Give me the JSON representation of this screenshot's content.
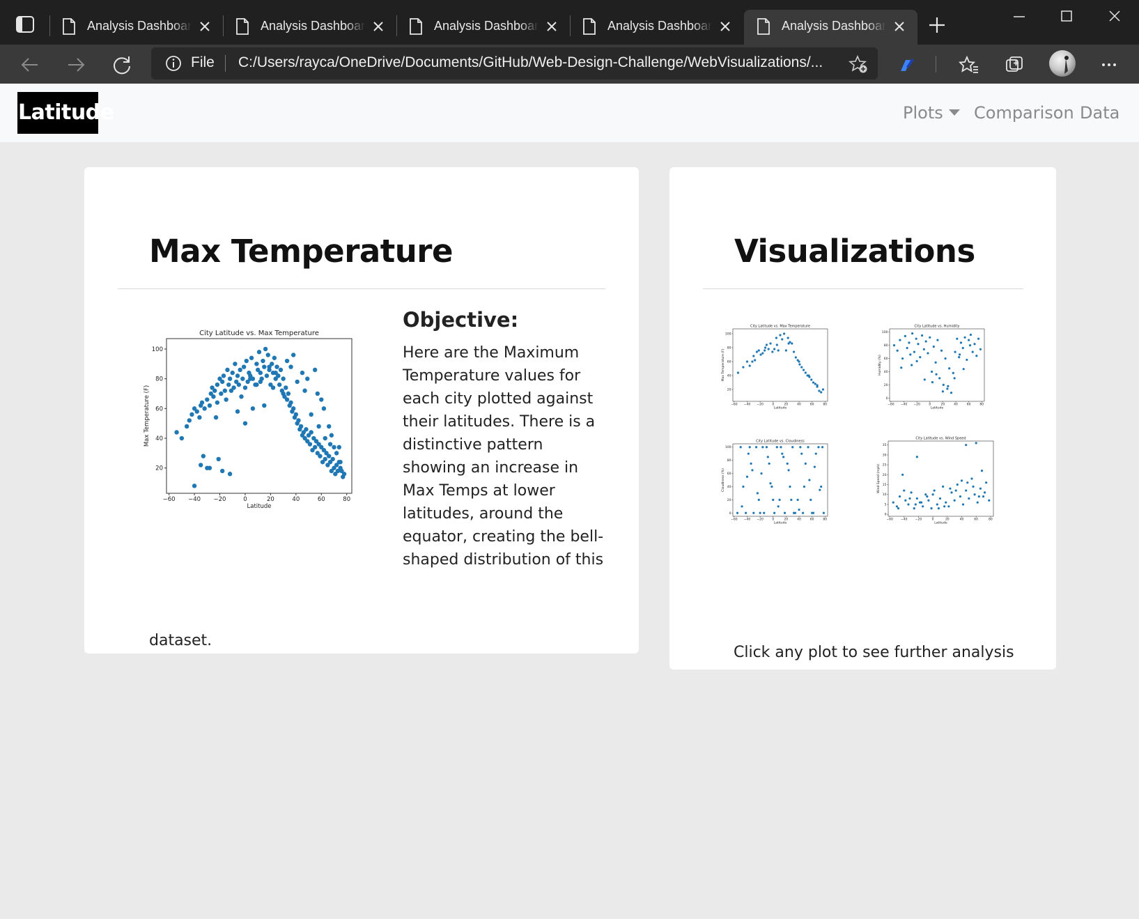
{
  "browser": {
    "tabs": [
      {
        "title": "Analysis Dashboard"
      },
      {
        "title": "Analysis Dashboard"
      },
      {
        "title": "Analysis Dashboard"
      },
      {
        "title": "Analysis Dashboard"
      },
      {
        "title": "Analysis Dashboard"
      }
    ],
    "active_tab_index": 4,
    "address_scheme_label": "File",
    "address_url": "C:/Users/rayca/OneDrive/Documents/GitHub/Web-Design-Challenge/WebVisualizations/..."
  },
  "site_nav": {
    "brand": "Latitude",
    "links": {
      "plots": "Plots",
      "comparison": "Comparison",
      "data": "Data"
    }
  },
  "main_card": {
    "title": "Max Temperature",
    "objective_heading": "Objective:",
    "objective_text": "Here are the Maximum Temperature values for each city plotted against their latitudes. There is a distinctive pattern showing an increase in Max Temps at lower latitudes, around the equator, creating the bell-shaped distribution of this",
    "objective_text_tail": "dataset."
  },
  "viz_card": {
    "title": "Visualizations",
    "caption": "Click any plot to see further analysis"
  },
  "chart_data": [
    {
      "type": "scatter",
      "title": "City Latitude vs. Max Temperature",
      "xlabel": "Latitude",
      "ylabel": "Max Temperature (F)",
      "xlim": [
        -62,
        84
      ],
      "ylim": [
        3,
        107
      ],
      "xticks": [
        -60,
        -40,
        -20,
        0,
        20,
        40,
        60,
        80
      ],
      "yticks": [
        20,
        40,
        60,
        80,
        100
      ],
      "color": "#1f77b4",
      "x": [
        -54,
        -50,
        -46,
        -44,
        -42,
        -40,
        -38,
        -36,
        -35,
        -34,
        -32,
        -30,
        -28,
        -27,
        -26,
        -25,
        -24,
        -22,
        -22,
        -20,
        -19,
        -18,
        -17,
        -16,
        -14,
        -13,
        -12,
        -10,
        -9,
        -8,
        -7,
        -6,
        -5,
        -4,
        -2,
        -1,
        0,
        1,
        2,
        3,
        4,
        5,
        6,
        8,
        9,
        10,
        11,
        12,
        13,
        14,
        15,
        16,
        17,
        18,
        19,
        20,
        21,
        22,
        23,
        24,
        25,
        26,
        27,
        28,
        29,
        30,
        31,
        32,
        33,
        34,
        35,
        36,
        37,
        38,
        39,
        40,
        41,
        42,
        43,
        44,
        45,
        46,
        47,
        48,
        49,
        50,
        51,
        52,
        53,
        54,
        55,
        56,
        57,
        58,
        59,
        60,
        61,
        62,
        63,
        64,
        65,
        66,
        67,
        68,
        69,
        70,
        71,
        72,
        73,
        74,
        75,
        76,
        77,
        78,
        -35,
        -28,
        -23,
        -15,
        -11,
        -3,
        4,
        12,
        19,
        26,
        33,
        41,
        47,
        52,
        58,
        63,
        67,
        72,
        75,
        -30,
        -18,
        -6,
        9,
        24,
        38,
        55,
        62,
        70,
        -40,
        -21,
        0,
        15,
        30,
        45,
        57,
        66,
        74,
        -33,
        -12,
        6,
        22,
        36,
        49,
        60,
        68
      ],
      "y": [
        44,
        40,
        48,
        52,
        56,
        60,
        58,
        54,
        62,
        64,
        60,
        66,
        62,
        70,
        74,
        68,
        72,
        76,
        64,
        80,
        70,
        78,
        82,
        72,
        86,
        76,
        80,
        84,
        74,
        90,
        78,
        82,
        76,
        86,
        80,
        88,
        74,
        92,
        78,
        84,
        82,
        94,
        80,
        76,
        90,
        86,
        98,
        84,
        80,
        92,
        88,
        100,
        82,
        96,
        86,
        76,
        90,
        84,
        94,
        80,
        88,
        82,
        76,
        86,
        72,
        80,
        68,
        74,
        66,
        70,
        62,
        64,
        58,
        60,
        54,
        56,
        50,
        52,
        46,
        48,
        42,
        44,
        40,
        46,
        38,
        42,
        36,
        44,
        32,
        40,
        34,
        38,
        30,
        36,
        28,
        34,
        24,
        32,
        26,
        30,
        22,
        28,
        24,
        18,
        26,
        20,
        16,
        22,
        18,
        24,
        20,
        18,
        14,
        16,
        22,
        20,
        54,
        66,
        72,
        68,
        80,
        78,
        88,
        82,
        92,
        78,
        72,
        56,
        48,
        40,
        36,
        30,
        24,
        20,
        18,
        58,
        76,
        84,
        96,
        86,
        60,
        34,
        8,
        26,
        50,
        62,
        70,
        84,
        70,
        48,
        34,
        28,
        16,
        60,
        74,
        88,
        80,
        66,
        42,
        38,
        24
      ]
    },
    {
      "type": "scatter",
      "title": "City Latitude vs. Max Temperature",
      "xlabel": "Latitude",
      "ylabel": "Max Temperature (F)",
      "xlim": [
        -62,
        84
      ],
      "ylim": [
        3,
        107
      ],
      "xticks": [
        -60,
        -40,
        -20,
        0,
        20,
        40,
        60,
        80
      ],
      "yticks": [
        20,
        40,
        60,
        80,
        100
      ],
      "color": "#1f77b4",
      "x": [
        -54,
        -46,
        -40,
        -36,
        -32,
        -28,
        -25,
        -22,
        -19,
        -16,
        -13,
        -10,
        -7,
        -4,
        -1,
        2,
        5,
        8,
        11,
        14,
        17,
        20,
        23,
        26,
        29,
        32,
        35,
        38,
        41,
        44,
        47,
        50,
        53,
        56,
        59,
        62,
        65,
        68,
        71,
        74,
        77,
        -30,
        -12,
        6,
        24,
        40,
        55,
        68
      ],
      "y": [
        44,
        52,
        60,
        54,
        60,
        62,
        74,
        76,
        70,
        72,
        76,
        84,
        78,
        86,
        74,
        78,
        94,
        76,
        98,
        92,
        100,
        76,
        94,
        88,
        86,
        74,
        66,
        62,
        56,
        52,
        48,
        44,
        40,
        38,
        34,
        30,
        28,
        24,
        18,
        16,
        20,
        68,
        80,
        84,
        86,
        60,
        40,
        26
      ]
    },
    {
      "type": "scatter",
      "title": "City Latitude vs. Humidity",
      "xlabel": "Latitude",
      "ylabel": "Humidity (%)",
      "xlim": [
        -62,
        84
      ],
      "ylim": [
        -5,
        105
      ],
      "xticks": [
        -60,
        -40,
        -20,
        0,
        20,
        40,
        60,
        80
      ],
      "yticks": [
        0,
        20,
        40,
        60,
        80,
        100
      ],
      "color": "#1f77b4",
      "x": [
        -55,
        -50,
        -46,
        -42,
        -38,
        -35,
        -32,
        -30,
        -27,
        -24,
        -21,
        -18,
        -15,
        -12,
        -9,
        -6,
        -3,
        0,
        3,
        6,
        9,
        12,
        15,
        18,
        21,
        24,
        27,
        30,
        33,
        36,
        39,
        42,
        45,
        48,
        51,
        54,
        57,
        60,
        63,
        66,
        69,
        72,
        75,
        78,
        -44,
        -28,
        -8,
        10,
        28,
        46,
        62,
        -20,
        4,
        20,
        38,
        52
      ],
      "y": [
        80,
        72,
        88,
        60,
        94,
        76,
        84,
        66,
        98,
        70,
        90,
        82,
        62,
        95,
        74,
        86,
        68,
        92,
        40,
        78,
        54,
        88,
        30,
        72,
        20,
        60,
        14,
        45,
        8,
        38,
        70,
        90,
        62,
        84,
        76,
        92,
        58,
        88,
        96,
        70,
        82,
        64,
        90,
        74,
        46,
        50,
        28,
        36,
        18,
        66,
        80,
        56,
        24,
        10,
        30,
        44
      ]
    },
    {
      "type": "scatter",
      "title": "City Latitude vs. Cloudiness",
      "xlabel": "Latitude",
      "ylabel": "Cloudiness (%)",
      "xlim": [
        -62,
        84
      ],
      "ylim": [
        -5,
        105
      ],
      "xticks": [
        -60,
        -40,
        -20,
        0,
        20,
        40,
        60,
        80
      ],
      "yticks": [
        0,
        20,
        40,
        60,
        80,
        100
      ],
      "color": "#1f77b4",
      "x": [
        -55,
        -50,
        -46,
        -42,
        -38,
        -34,
        -30,
        -26,
        -22,
        -18,
        -14,
        -10,
        -6,
        -2,
        2,
        6,
        10,
        14,
        18,
        22,
        26,
        30,
        34,
        38,
        42,
        46,
        50,
        54,
        58,
        62,
        66,
        70,
        74,
        78,
        -40,
        -24,
        -8,
        8,
        24,
        40,
        56,
        72,
        -48,
        -32,
        -16,
        0,
        16,
        32,
        48,
        64,
        -36,
        -20,
        -4,
        12,
        28,
        44,
        60,
        76
      ],
      "y": [
        0,
        100,
        40,
        0,
        90,
        75,
        0,
        100,
        20,
        60,
        0,
        100,
        75,
        40,
        0,
        100,
        20,
        90,
        0,
        75,
        40,
        100,
        0,
        20,
        100,
        0,
        75,
        100,
        20,
        0,
        90,
        100,
        40,
        0,
        55,
        30,
        85,
        10,
        65,
        5,
        50,
        35,
        10,
        65,
        100,
        20,
        85,
        0,
        40,
        70,
        100,
        0,
        45,
        100,
        20,
        90,
        0,
        100
      ]
    },
    {
      "type": "scatter",
      "title": "City Latitude vs. Wind Speed",
      "xlabel": "Latitude",
      "ylabel": "Wind Speed (mph)",
      "xlim": [
        -62,
        84
      ],
      "ylim": [
        -1,
        37
      ],
      "xticks": [
        -60,
        -40,
        -20,
        0,
        20,
        40,
        60,
        80
      ],
      "yticks": [
        0,
        5,
        10,
        15,
        20,
        25,
        30,
        35
      ],
      "color": "#1f77b4",
      "x": [
        -55,
        -50,
        -46,
        -42,
        -38,
        -34,
        -30,
        -26,
        -22,
        -18,
        -14,
        -10,
        -6,
        -2,
        2,
        6,
        10,
        14,
        18,
        22,
        26,
        30,
        34,
        38,
        42,
        46,
        50,
        54,
        58,
        62,
        66,
        70,
        74,
        78,
        -40,
        -24,
        -8,
        8,
        24,
        40,
        56,
        72,
        -48,
        -32,
        -16,
        0,
        16,
        32,
        48,
        64,
        -22,
        46,
        60,
        68
      ],
      "y": [
        6,
        4,
        9,
        20,
        7,
        5,
        11,
        3,
        8,
        6,
        4,
        10,
        7,
        3,
        12,
        5,
        8,
        14,
        6,
        4,
        11,
        7,
        15,
        9,
        5,
        12,
        8,
        18,
        10,
        6,
        13,
        9,
        16,
        7,
        12,
        5,
        9,
        3,
        13,
        17,
        14,
        11,
        3,
        8,
        6,
        10,
        4,
        12,
        16,
        9,
        29,
        35,
        36,
        22
      ]
    }
  ]
}
